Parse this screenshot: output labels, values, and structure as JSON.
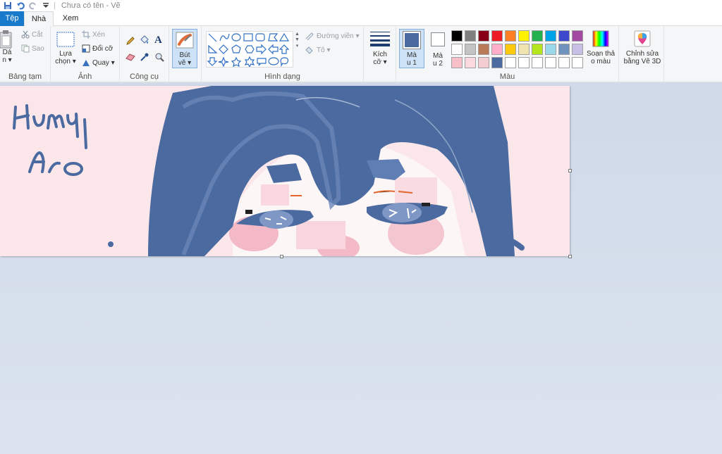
{
  "titlebar": {
    "title": "Chưa có tên - Vẽ",
    "quick_access": [
      "save-icon",
      "undo-icon",
      "redo-icon",
      "customize-qat-icon"
    ]
  },
  "tabs": [
    {
      "label": "Tệp"
    },
    {
      "label": "Nhà"
    },
    {
      "label": "Xem"
    }
  ],
  "clipboard": {
    "paste_label_1": "Dá",
    "paste_label_2": "n",
    "cut": "Cắt",
    "copy": "Sao",
    "group": "Bảng tạm"
  },
  "image": {
    "select_label_1": "Lựa",
    "select_label_2": "chọn",
    "crop": "Xén",
    "resize": "Đổi cỡ",
    "rotate": "Quay",
    "group": "Ảnh"
  },
  "tools": {
    "group": "Công cụ"
  },
  "brushes": {
    "label_1": "Bút",
    "label_2": "vẽ"
  },
  "shapes": {
    "outline": "Đường viền",
    "fill": "Tô",
    "group": "Hình dạng"
  },
  "size": {
    "label_1": "Kích",
    "label_2": "cỡ"
  },
  "colors": {
    "color1_label_1": "Mà",
    "color1_label_2": "u 1",
    "color2_label_1": "Mà",
    "color2_label_2": "u 2",
    "edit_label_1": "Soạn thả",
    "edit_label_2": "o màu",
    "paint3d_label_1": "Chỉnh sửa",
    "paint3d_label_2": "bằng Vẽ 3D",
    "group": "Màu",
    "color1": "#4a6aa0",
    "color2": "#ffffff",
    "palette_row1": [
      "#000000",
      "#7f7f7f",
      "#880015",
      "#ed1c24",
      "#ff7f27",
      "#fff200",
      "#22b14c",
      "#00a2e8",
      "#3f48cc",
      "#a349a4"
    ],
    "palette_row2": [
      "#ffffff",
      "#c3c3c3",
      "#b97a57",
      "#ffaec9",
      "#ffc90e",
      "#efe4b0",
      "#b5e61d",
      "#99d9ea",
      "#7092be",
      "#c8bfe7"
    ],
    "palette_row3": [
      "#f7c0c8",
      "#fbd9de",
      "#f4cdd3",
      "#4a6aa0",
      "#ffffff",
      "#ffffff",
      "#ffffff",
      "#ffffff",
      "#ffffff",
      "#ffffff"
    ]
  },
  "canvas": {
    "background": "#fbe7ea",
    "stroke_color": "#4a6aa0"
  }
}
